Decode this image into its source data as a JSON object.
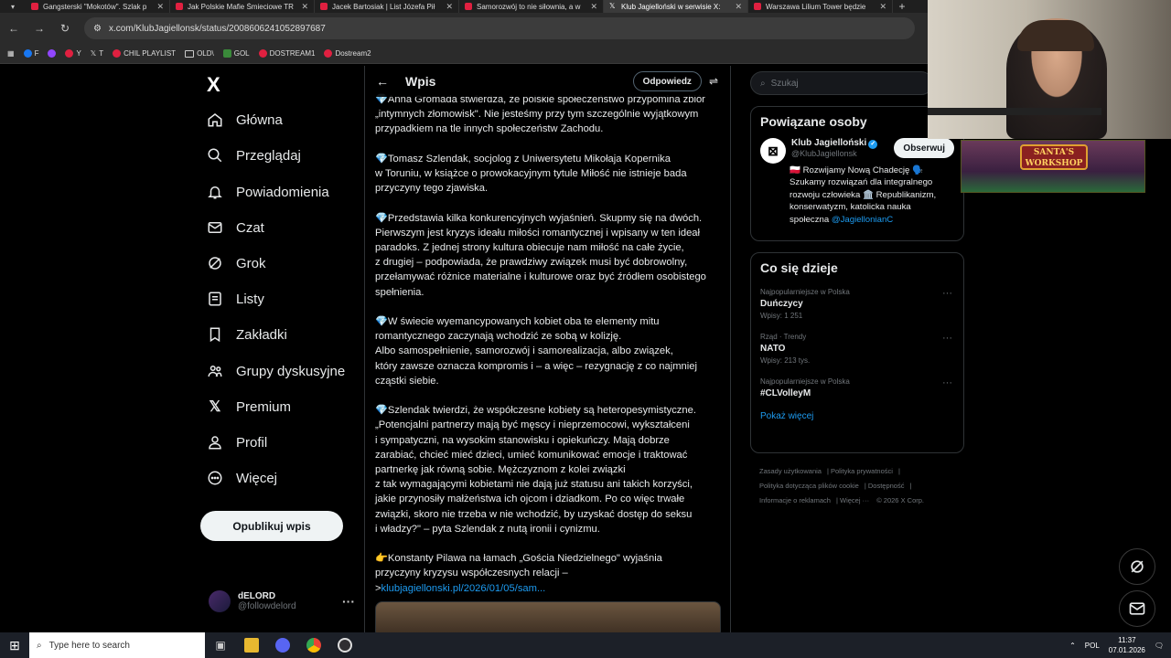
{
  "browser": {
    "tabs": [
      {
        "label": "Gangsterski \"Mokotów\". Szlak p",
        "active": false
      },
      {
        "label": "Jak Polskie Mafie Śmieciowe TR",
        "active": false
      },
      {
        "label": "Jacek Bartosiak | List Józefa Pił",
        "active": false
      },
      {
        "label": "Samorozwój to nie siłownia, a w",
        "active": false
      },
      {
        "label": "Klub Jagielloński w serwisie X:",
        "active": true
      },
      {
        "label": "Warszawa Lilium Tower będzie",
        "active": false
      }
    ],
    "new_tab": "+",
    "url": "x.com/KlubJagiellonsk/status/2008606241052897687",
    "bookmarks": [
      "F",
      "Y",
      "T",
      "CHIL PLAYLIST",
      "OLD\\",
      "GOL",
      "DOSTREAM1",
      "Dostream2"
    ]
  },
  "sidebar": {
    "logo": "X",
    "items": [
      {
        "label": "Główna",
        "icon": "home-icon"
      },
      {
        "label": "Przeglądaj",
        "icon": "search-icon"
      },
      {
        "label": "Powiadomienia",
        "icon": "bell-icon"
      },
      {
        "label": "Czat",
        "icon": "mail-icon"
      },
      {
        "label": "Grok",
        "icon": "grok-icon"
      },
      {
        "label": "Listy",
        "icon": "list-icon"
      },
      {
        "label": "Zakładki",
        "icon": "bookmark-icon"
      },
      {
        "label": "Grupy dyskusyjne",
        "icon": "groups-icon"
      },
      {
        "label": "Premium",
        "icon": "x-icon"
      },
      {
        "label": "Profil",
        "icon": "person-icon"
      },
      {
        "label": "Więcej",
        "icon": "more-icon"
      }
    ],
    "publish_button": "Opublikuj wpis",
    "user": {
      "name": "dELORD",
      "handle": "@followdelord",
      "menu": "···"
    }
  },
  "main": {
    "title": "Wpis",
    "reply_button": "Odpowiedz",
    "paragraphs": [
      "💎Anna Gromada stwierdza, że polskie społeczeństwo przypomina zbiór\n„intymnych złomowisk\". Nie jesteśmy przy tym szczególnie wyjątkowym\nprzypadkiem na tle innych społeczeństw Zachodu.",
      "💎Tomasz Szlendak, socjolog z Uniwersytetu Mikołaja Kopernika\nw Toruniu, w książce o prowokacyjnym tytule Miłość nie istnieje bada\nprzyczyny tego zjawiska.",
      "💎Przedstawia kilka konkurencyjnych wyjaśnień. Skupmy się na dwóch.\nPierwszym jest kryzys ideału miłości romantycznej i wpisany w ten ideał\nparadoks. Z jednej strony kultura obiecuje nam miłość na całe życie,\nz drugiej – podpowiada, że prawdziwy związek musi być dobrowolny,\nprzełamywać różnice materialne i kulturowe oraz być źródłem osobistego\nspełnienia.",
      "💎W świecie wyemancypowanych kobiet oba te elementy mitu\nromantycznego zaczynają wchodzić ze sobą w kolizję.\nAlbo samospełnienie, samorozwój i samorealizacja, albo związek,\nktóry zawsze oznacza kompromis i – a więc – rezygnację z co najmniej\ncząstki siebie.",
      "💎Szlendak twierdzi, że współczesne kobiety są heteropesymistyczne.\n„Potencjalni partnerzy mają być męscy i nieprzemocowi, wykształceni\ni sympatyczni, na wysokim stanowisku i opiekuńczy. Mają dobrze\nzarabiać, chcieć mieć dzieci, umieć komunikować emocje i traktować\npartnerkę jak równą sobie. Mężczyznom z kolei związki\nz tak wymagającymi kobietami nie dają już statusu ani takich korzyści,\njakie przynosiły małżeństwa ich ojcom i dziadkom. Po co więc trwałe\nzwiązki, skoro nie trzeba w nie wchodzić, by uzyskać dostęp do seksu\ni władzy?\" – pyta Szlendak z nutą ironii i cynizmu."
    ],
    "last_paragraph": "👉Konstanty Pilawa na łamach „Gościa Niedzielnego\" wyjaśnia\nprzyczyny kryzysu współczesnych relacji –\n>",
    "link": "klubjagiellonski.pl/2026/01/05/sam..."
  },
  "right": {
    "search_placeholder": "Szukaj",
    "related_title": "Powiązane osoby",
    "account": {
      "name": "Klub Jagielloński",
      "handle": "@KlubJagiellonsk",
      "follow": "Obserwuj",
      "bio": "🇵🇱 Rozwijamy Nową Chadecję 🗣️\nSzukamy rozwiązań dla integralnego\nrozwoju człowieka 🏛️ Republikanizm,\nkonserwatyzm, katolicka nauka\nspołeczna ",
      "bio_link": "@JagiellonianC"
    },
    "trends_title": "Co się dzieje",
    "trends": [
      {
        "category": "Najpopularniejsze w Polska",
        "name": "Duńczycy",
        "count": "Wpisy: 1 251"
      },
      {
        "category": "Rząd · Trendy",
        "name": "NATO",
        "count": "Wpisy: 213 tys."
      },
      {
        "category": "Najpopularniejsze w Polska",
        "name": "#CLVolleyM",
        "count": ""
      }
    ],
    "show_more": "Pokaż więcej",
    "footer": [
      "Zasady użytkowania",
      "Polityka prywatności",
      "Polityka dotycząca plików cookie",
      "Dostępność",
      "Informacje o reklamach",
      "Więcej ···",
      "© 2026 X Corp."
    ]
  },
  "overlay": {
    "sign": "SANTA'S WORKSHOP"
  },
  "taskbar": {
    "search_placeholder": "Type here to search",
    "lang": "POL",
    "time": "11:37",
    "date": "07.01.2026"
  }
}
